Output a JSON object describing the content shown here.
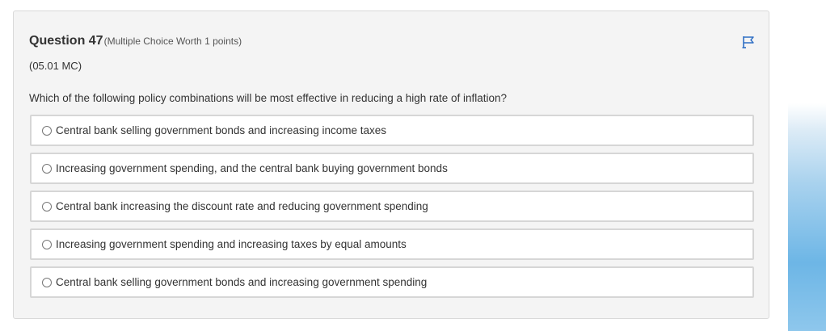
{
  "question": {
    "title": "Question 47",
    "meta": "(Multiple Choice Worth 1 points)",
    "code": "(05.01 MC)",
    "prompt": "Which of the following policy combinations will be most effective in reducing a high rate of inflation?",
    "flag_icon": "flag-icon"
  },
  "options": [
    {
      "label": "Central bank selling government bonds and increasing income taxes",
      "selected": false
    },
    {
      "label": "Increasing government spending, and the central bank buying government bonds",
      "selected": false
    },
    {
      "label": "Central bank increasing the discount rate and reducing government spending",
      "selected": false
    },
    {
      "label": "Increasing government spending and increasing taxes by equal amounts",
      "selected": false
    },
    {
      "label": "Central bank selling government bonds and increasing government spending",
      "selected": false
    }
  ],
  "colors": {
    "flag": "#2f6fc4",
    "card_bg": "#f4f4f4",
    "option_border": "#d6d6d6",
    "side_accent": "#6db6e6"
  }
}
